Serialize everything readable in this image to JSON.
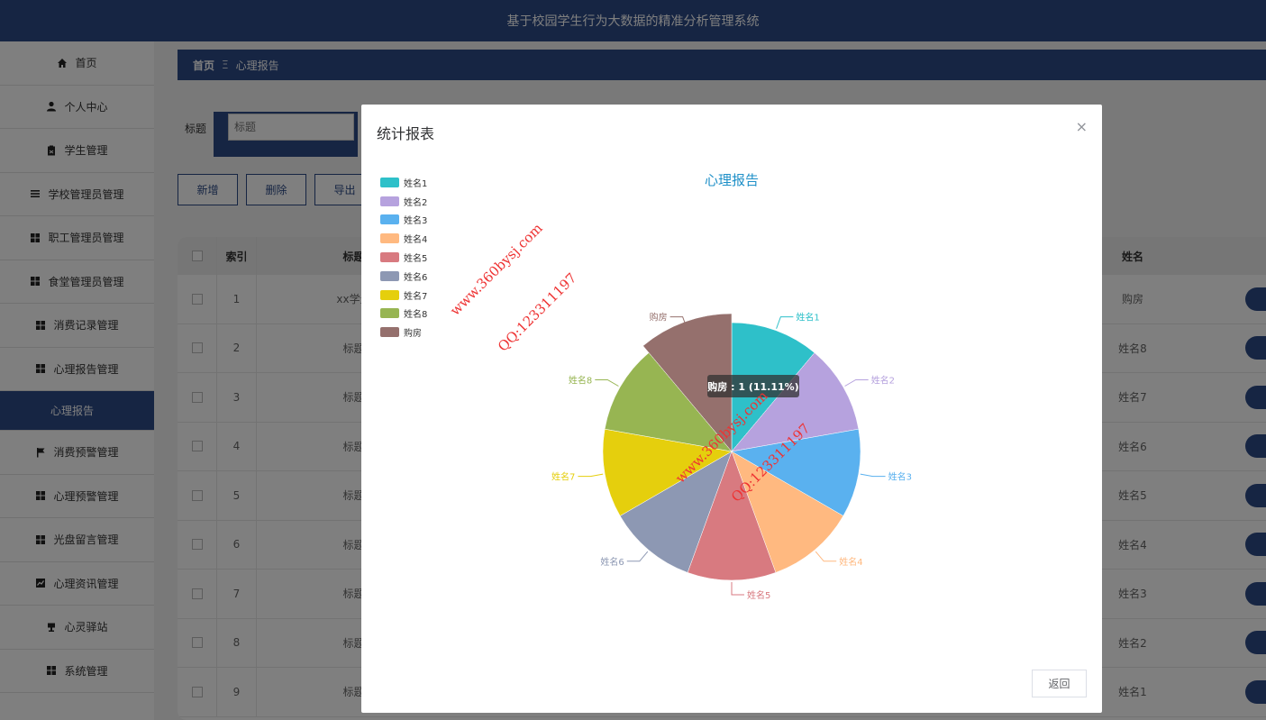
{
  "app": {
    "title": "基于校园学生行为大数据的精准分析管理系统"
  },
  "sidebar": {
    "items": [
      {
        "label": "首页",
        "icon": "home-icon"
      },
      {
        "label": "个人中心",
        "icon": "user-icon"
      },
      {
        "label": "学生管理",
        "icon": "clipboard-icon"
      },
      {
        "label": "学校管理员管理",
        "icon": "list-icon"
      },
      {
        "label": "职工管理员管理",
        "icon": "grid-icon"
      },
      {
        "label": "食堂管理员管理",
        "icon": "grid-icon"
      },
      {
        "label": "消费记录管理",
        "icon": "grid-icon"
      },
      {
        "label": "心理报告管理",
        "icon": "grid-icon"
      },
      {
        "label": "心理报告",
        "icon": ""
      },
      {
        "label": "消费预警管理",
        "icon": "flag-icon"
      },
      {
        "label": "心理预警管理",
        "icon": "grid-icon"
      },
      {
        "label": "光盘留言管理",
        "icon": "grid-icon"
      },
      {
        "label": "心理资讯管理",
        "icon": "chart-icon"
      },
      {
        "label": "心灵驿站",
        "icon": "cup-icon"
      },
      {
        "label": "系统管理",
        "icon": "grid-icon"
      }
    ]
  },
  "breadcrumb": {
    "home": "首页",
    "separator": "Ξ",
    "current": "心理报告"
  },
  "search": {
    "label": "标题",
    "placeholder": "标题"
  },
  "toolbar": {
    "add_label": "新增",
    "delete_label": "删除",
    "export_label": "导出"
  },
  "table": {
    "headers": {
      "index": "索引",
      "title": "标题",
      "name": "姓名"
    },
    "rows": [
      {
        "index": "1",
        "title": "xx学生",
        "name": "购房"
      },
      {
        "index": "2",
        "title": "标题",
        "name": "姓名8"
      },
      {
        "index": "3",
        "title": "标题",
        "name": "姓名7"
      },
      {
        "index": "4",
        "title": "标题",
        "name": "姓名6"
      },
      {
        "index": "5",
        "title": "标题",
        "name": "姓名5"
      },
      {
        "index": "6",
        "title": "标题",
        "name": "姓名4"
      },
      {
        "index": "7",
        "title": "标题",
        "name": "姓名3"
      },
      {
        "index": "8",
        "title": "标题",
        "name": "姓名2"
      },
      {
        "index": "9",
        "title": "标题",
        "name": "姓名1"
      }
    ]
  },
  "modal": {
    "title": "统计报表",
    "close_icon": "×",
    "back_label": "返回"
  },
  "watermark": {
    "site": "www.360bysj.com",
    "qq": "QQ:123311197"
  },
  "chart_data": {
    "type": "pie",
    "title": "心理报告",
    "legend_position": "top-left",
    "categories": [
      "姓名1",
      "姓名2",
      "姓名3",
      "姓名4",
      "姓名5",
      "姓名6",
      "姓名7",
      "姓名8",
      "购房"
    ],
    "values": [
      1,
      1,
      1,
      1,
      1,
      1,
      1,
      1,
      1
    ],
    "colors": [
      "#2ec0c9",
      "#b6a2de",
      "#5ab1ef",
      "#ffb980",
      "#d87a80",
      "#8d98b3",
      "#e5cf0d",
      "#97b552",
      "#95706d"
    ],
    "highlighted": "购房",
    "tooltip": "购房 : 1 (11.11%)"
  }
}
